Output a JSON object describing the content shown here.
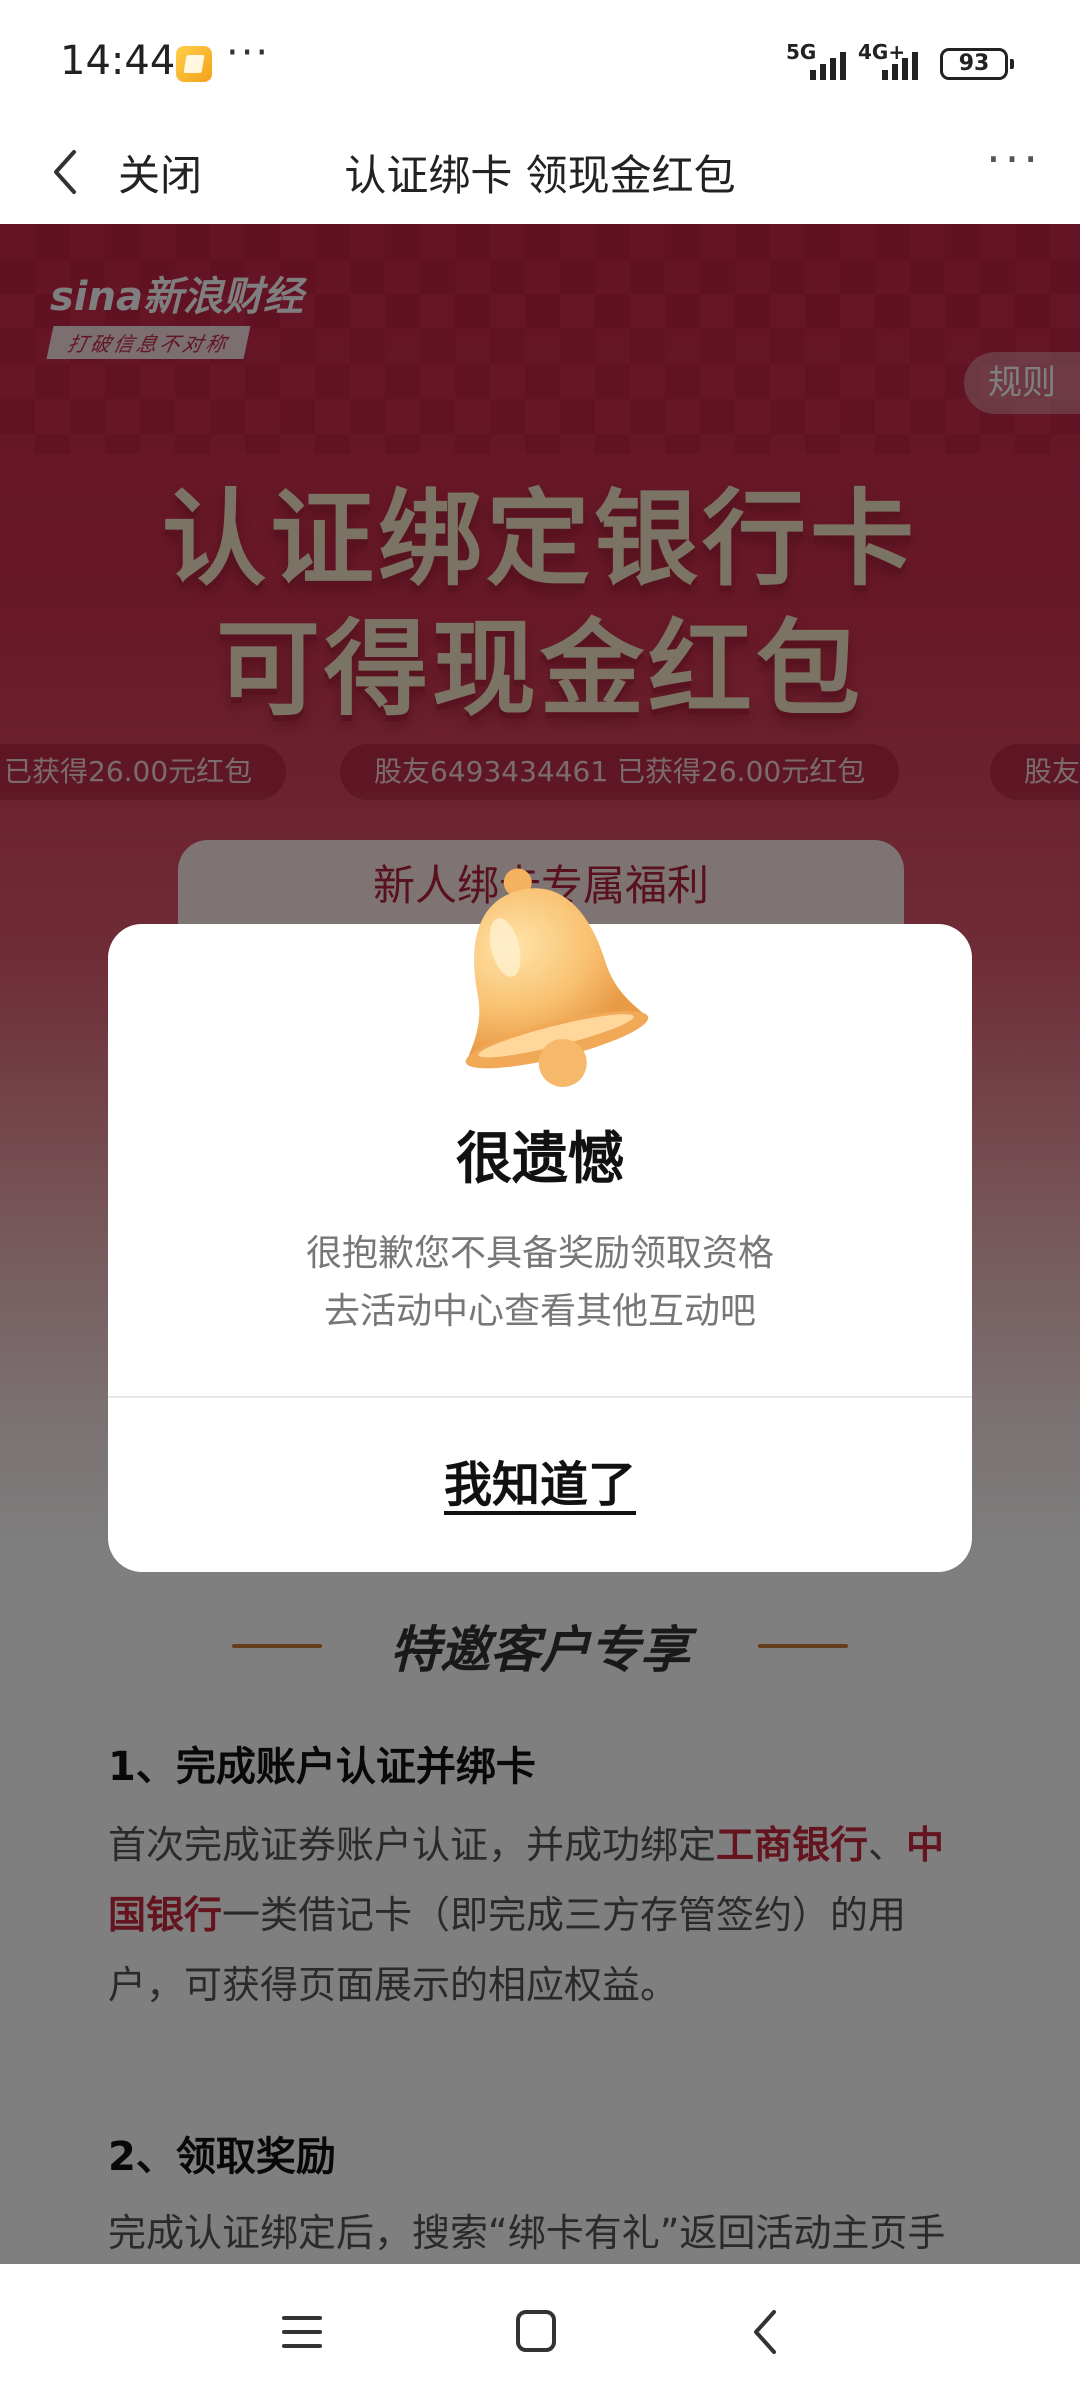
{
  "status_bar": {
    "time": "14:44",
    "more": "···",
    "signal_1": "5G",
    "signal_2": "4G+",
    "battery": "93"
  },
  "nav": {
    "close_label": "关闭",
    "title": "认证绑卡 领现金红包",
    "more": "···"
  },
  "banner": {
    "brand_name": "sina新浪财经",
    "brand_slogan": "打破信息不对称",
    "rules_label": "规则",
    "headline_1": "认证绑定银行卡",
    "headline_2": "可得现金红包",
    "tickers": [
      "已获得26.00元红包",
      "股友6493434461 已获得26.00元红包",
      "股友"
    ],
    "new_user_tab": "新人绑卡专属福利"
  },
  "card": {
    "title": "特邀客户专享",
    "step1_title": "1、完成账户认证并绑卡",
    "step1_text_a": "首次完成证券账户认证，并成功绑定",
    "step1_bank_1": "工商银行",
    "step1_sep": "、",
    "step1_bank_2": "中国银行",
    "step1_text_b": "一类借记卡（即完成三方存管签约）的用户，可获得页面展示的相应权益。",
    "step2_title": "2、领取奖励",
    "step2_text": "完成认证绑定后，搜索“绑卡有礼”返回活动主页手"
  },
  "dialog": {
    "icon": "bell-icon",
    "title": "很遗憾",
    "message_line_1": "很抱歉您不具备奖励领取资格",
    "message_line_2": "去活动中心查看其他互动吧",
    "ok_label": "我知道了"
  },
  "system_nav": {
    "menu": "menu-icon",
    "home": "home-icon",
    "back": "back-icon"
  },
  "colors": {
    "brand_red": "#c8283c",
    "hero_top": "#c8284a",
    "headline_gold": "#f7e7c6",
    "overlay": "rgba(0,0,0,0.5)"
  }
}
